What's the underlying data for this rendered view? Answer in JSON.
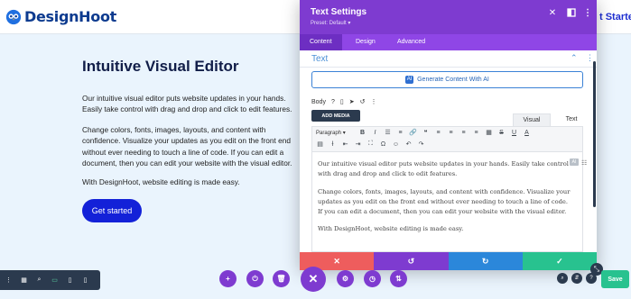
{
  "header": {
    "logo_text": "DesignHoot",
    "cta_label": "t Started"
  },
  "hero": {
    "title": "Intuitive Visual Editor",
    "paragraph1": "Our intuitive visual editor puts website updates in your hands. Easily take control with drag and drop and click to edit features.",
    "paragraph2": "Change colors, fonts, images, layouts, and content with confidence. Visualize your updates as you edit on the front end without ever needing to touch a line of code. If you can edit a document, then you can edit your website with the visual editor.",
    "paragraph3": "With DesignHoot, website editing is made easy.",
    "button_label": "Get started"
  },
  "modal": {
    "title": "Text Settings",
    "preset": "Preset: Default ▾",
    "tabs": [
      "Content",
      "Design",
      "Advanced"
    ],
    "section_title": "Text",
    "ai_button_label": "Generate Content With AI",
    "body_label": "Body",
    "add_media_label": "ADD MEDIA",
    "editor_tabs": [
      "Visual",
      "Text"
    ],
    "format_select": "Paragraph",
    "editor_paragraphs": [
      "Our intuitive visual editor puts website updates in your hands. Easily take control with drag and drop and click to edit features.",
      "Change colors, fonts, images, layouts, and content with confidence. Visualize your updates as you edit on the front end without ever needing to touch a line of code. If you can edit a document, then you can edit your website with the visual editor.",
      "With DesignHoot, website editing is made easy."
    ],
    "ai_chip": "AI"
  },
  "builder": {
    "save_label": "Save"
  },
  "colors": {
    "accent_purple": "#7e3bd0",
    "cancel_red": "#ee5d5d",
    "redo_blue": "#2b87da",
    "confirm_green": "#28c28f",
    "hero_button_blue": "#1321d8"
  },
  "icons": {
    "close": "close-icon",
    "split": "split-view-icon",
    "kebab": "kebab-menu-icon",
    "undo": "undo-icon",
    "redo": "redo-icon",
    "check": "check-icon"
  }
}
